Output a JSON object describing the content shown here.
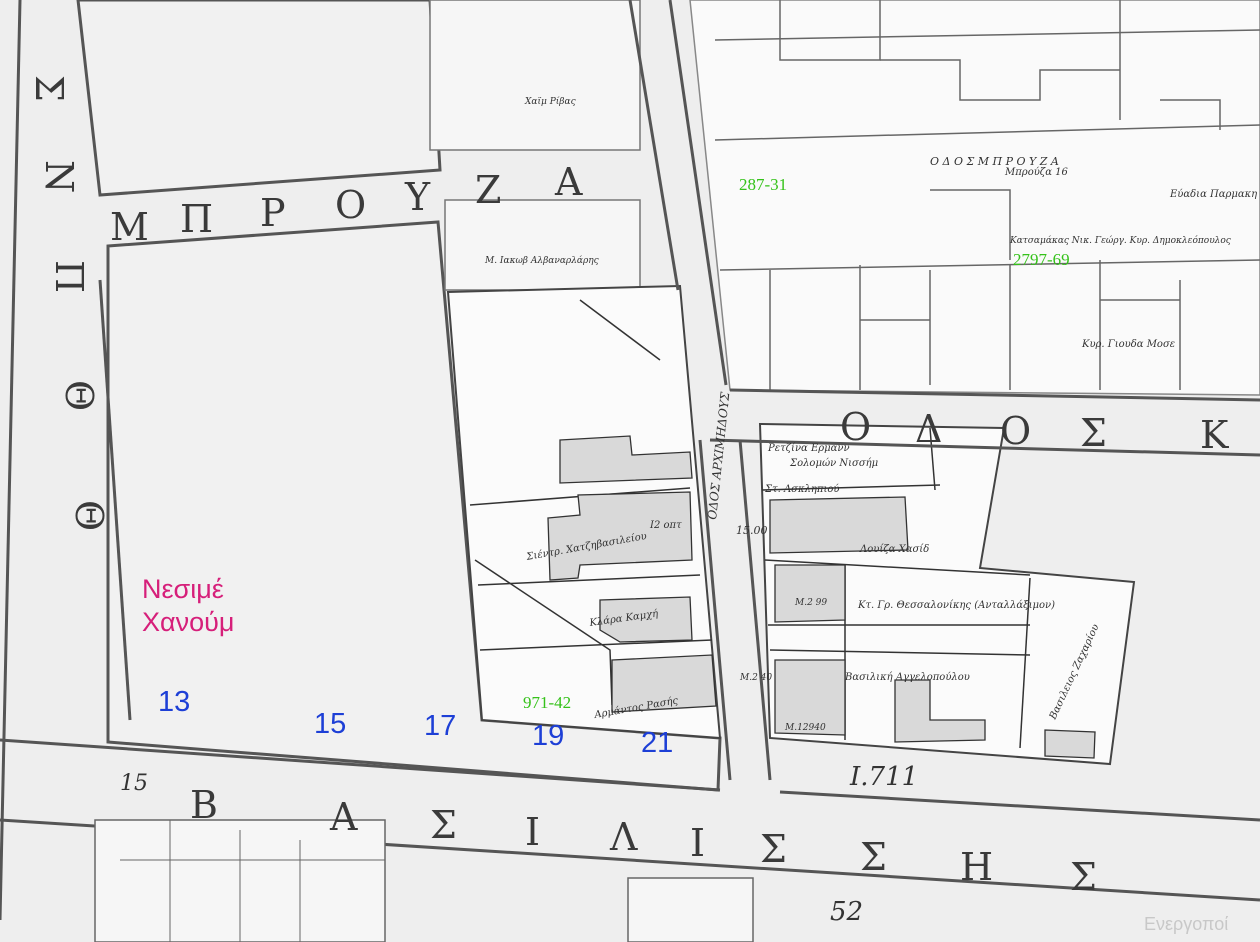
{
  "owner_label": {
    "line1": "Νεσιμέ",
    "line2": "Χανούμ",
    "color": "#d61f7a"
  },
  "plot_numbers": [
    "13",
    "15",
    "17",
    "19",
    "21"
  ],
  "reference_codes": [
    "287-31",
    "2797-69",
    "971-42"
  ],
  "streets": {
    "west_vertical": [
      "Σ",
      "Ν",
      "Π",
      "Θ",
      "Θ"
    ],
    "mprouza": [
      "Μ",
      "Π",
      "Ρ",
      "Ο",
      "Υ",
      "Ζ",
      "Α"
    ],
    "vasilissis": [
      "Β",
      "Α",
      "Σ",
      "Ι",
      "Λ",
      "Ι",
      "Σ",
      "Σ",
      "Η",
      "Σ"
    ],
    "odos_north": "Ο Δ Ο Σ   Μ Π Ρ Ο Υ Ζ Α",
    "odos_archimidous": "ΟΔΟΣ ΑΡΧΙΜΗΔΟΥΣ",
    "road_east": [
      "Ο",
      "Δ",
      "Ο",
      "Σ",
      "Κ"
    ],
    "width_marks": [
      "15",
      "15.00",
      "52",
      "Ι.711"
    ]
  },
  "parcel_texts": [
    "Μπρούζα 16",
    "Εύαδια Παρμακη",
    "Κατσαμάκας Νικ. Γεώργ. Κυρ. Δημοκλεόπουλος",
    "Κυρ. Γιουδα Μοσε",
    "Ρετζίνα Ερμανν",
    "Σολομών Νισσήμ",
    "Στ. Ασκληπιού",
    "Λουίζα Χασίδ",
    "Σιέντρ. Χατζηβασιλείου",
    "Κλάρα Καμχή",
    "Κτ. Γρ. Θεσσαλονίκης (Ανταλλάξιμον)",
    "Βασιλική Αγγελοπούλου",
    "Βασιλειος Ζαχαρίου",
    "Αρμάντος Ρασής",
    "Χαϊμ Ρίβας",
    "Μ. Ιακωβ Αλβαναρλάρης",
    "Ι2 οπτ",
    "Μ.2 99",
    "Μ.12940",
    "Μ.2 40"
  ],
  "watermark": "Ενεργοποί"
}
